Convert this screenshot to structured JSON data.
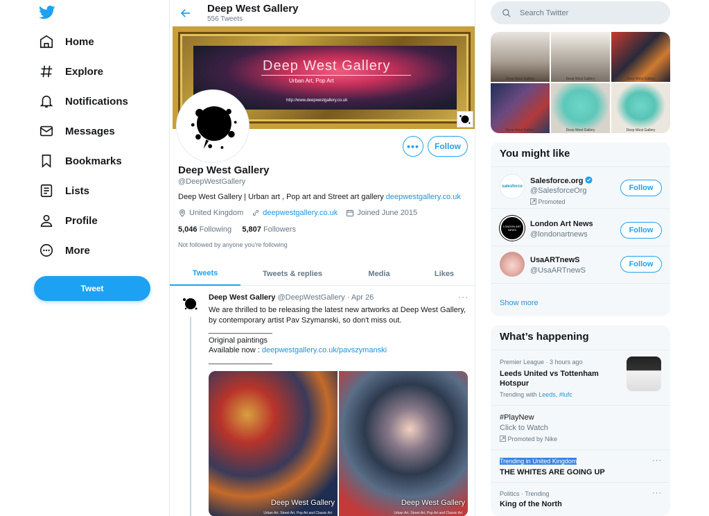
{
  "nav": {
    "logo": "twitter-bird-icon",
    "items": [
      {
        "label": "Home",
        "icon": "home-icon"
      },
      {
        "label": "Explore",
        "icon": "hashtag-icon"
      },
      {
        "label": "Notifications",
        "icon": "bell-icon"
      },
      {
        "label": "Messages",
        "icon": "envelope-icon"
      },
      {
        "label": "Bookmarks",
        "icon": "bookmark-icon"
      },
      {
        "label": "Lists",
        "icon": "list-icon"
      },
      {
        "label": "Profile",
        "icon": "person-icon"
      },
      {
        "label": "More",
        "icon": "more-circle-icon"
      }
    ],
    "tweet_button": "Tweet"
  },
  "header": {
    "title": "Deep West Gallery",
    "subtitle": "556 Tweets"
  },
  "banner": {
    "title": "Deep West Gallery",
    "subtitle": "Urban Art, Pop Art",
    "url": "http://www.deepwestgallery.co.uk"
  },
  "profile": {
    "name": "Deep West Gallery",
    "handle": "@DeepWestGallery",
    "bio": "Deep West Gallery | Urban art , Pop art and Street art gallery ",
    "bio_link": "deepwestgallery.co.uk",
    "location": "United Kingdom",
    "website": "deepwestgallery.co.uk",
    "joined": "Joined June 2015",
    "following_count": "5,046",
    "following_label": "Following",
    "followers_count": "5,807",
    "followers_label": "Followers",
    "note": "Not followed by anyone you're following",
    "more_button": "•••",
    "follow_button": "Follow"
  },
  "tabs": [
    "Tweets",
    "Tweets & replies",
    "Media",
    "Likes"
  ],
  "tweet": {
    "name": "Deep West Gallery",
    "handle": "@DeepWestGallery",
    "sep": " · ",
    "date": "Apr 26",
    "more": "···",
    "line1": "We are thrilled to be releasing the latest new artworks at Deep West Gallery, by contemporary artist Pav Szymanski, so don't miss out.",
    "line2": "_______________",
    "line3": "Original paintings",
    "line4_prefix": "Available now : ",
    "line4_link": "deepwestgallery.co.uk/pavszymanski",
    "line5": "_______________",
    "media_watermark": "Deep West Gallery",
    "media_watermark_small": "Urban Art, Street Art, Pop Art and Classic Art"
  },
  "right": {
    "search_placeholder": "Search Twitter",
    "grid_label": "Deep West Gallery",
    "you_might_like": {
      "title": "You might like",
      "items": [
        {
          "name": "Salesforce.org",
          "handle": "@SalesforceOrg",
          "promoted": "Promoted",
          "follow": "Follow",
          "avatar_text": "salesforce"
        },
        {
          "name": "London Art News",
          "handle": "@londonartnews",
          "follow": "Follow",
          "avatar_text": "LONDON ART NEWS"
        },
        {
          "name": "UsaARTnewS",
          "handle": "@UsaARTnewS",
          "follow": "Follow"
        }
      ],
      "show_more": "Show more"
    },
    "whats_happening": {
      "title": "What’s happening",
      "trends": [
        {
          "meta": "Premier League · 3 hours ago",
          "title": "Leeds United vs Tottenham Hotspur",
          "sub_prefix": "Trending with ",
          "sub_links": "Leeds, #lufc"
        },
        {
          "title": "#PlayNew",
          "sub": "Click to Watch",
          "promoted": "Promoted by Nike"
        },
        {
          "meta": "Trending in United Kingdom",
          "title": "THE WHITES ARE GOING UP",
          "more": "···"
        },
        {
          "meta": "Politics · Trending",
          "title": "King of the North",
          "more": "···"
        }
      ]
    }
  },
  "colors": {
    "accent": "#1da1f2",
    "link": "#1b95e0",
    "text": "#14171a",
    "muted": "#657786",
    "panel": "#f5f8fa"
  }
}
